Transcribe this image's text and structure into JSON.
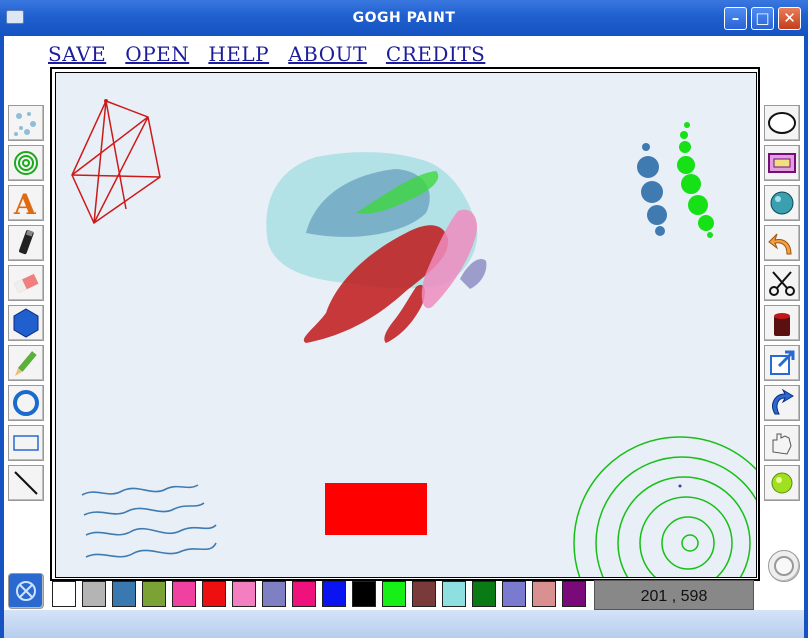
{
  "window": {
    "title": "GOGH PAINT"
  },
  "menu": [
    "SAVE",
    "OPEN",
    "HELP",
    "ABOUT",
    "CREDITS"
  ],
  "left_tools": [
    "spray-icon",
    "spiral-icon",
    "text-icon",
    "marker-icon",
    "eraser-icon",
    "polygon-icon",
    "pencil-icon",
    "circle-outline-icon",
    "rectangle-icon",
    "line-icon"
  ],
  "right_tools": [
    "ellipse-icon",
    "rectangle-pattern-icon",
    "sphere-icon",
    "undo-icon",
    "scissors-icon",
    "paint-bucket-icon",
    "export-icon",
    "redo-icon",
    "hand-icon",
    "green-ball-icon"
  ],
  "palette": [
    "#ffffff",
    "#b4b4b4",
    "#3a78b0",
    "#7ba235",
    "#f041a0",
    "#ee1010",
    "#f47fc0",
    "#7f7fc4",
    "#f0127c",
    "#0a14f0",
    "#000000",
    "#16f016",
    "#7a3a3a",
    "#8ee0e0",
    "#0a7a14",
    "#7a7ad0",
    "#d89090",
    "#7a0a7a"
  ],
  "coordinates": "201 , 598"
}
